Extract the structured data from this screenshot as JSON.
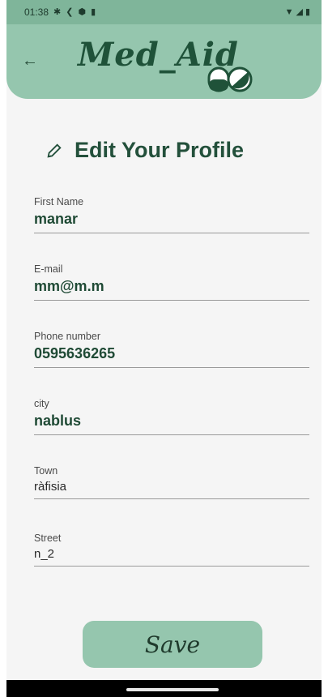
{
  "status_bar": {
    "time": "01:38",
    "left_icons": [
      "gear-icon",
      "back-chevron-icon",
      "shield-icon",
      "sd-card-icon"
    ],
    "right_icons": [
      "wifi-icon",
      "signal-icon",
      "battery-icon"
    ]
  },
  "header": {
    "title": "Med_Aid",
    "back_label": "←"
  },
  "page": {
    "title": "Edit Your Profile"
  },
  "form": {
    "fields": [
      {
        "label": "First Name",
        "value": "manar"
      },
      {
        "label": "E-mail",
        "value": "mm@m.m"
      },
      {
        "label": "Phone number",
        "value": "0595636265"
      },
      {
        "label": "city",
        "value": "nablus"
      },
      {
        "label": "Town",
        "value": "ràfisia"
      },
      {
        "label": "Street",
        "value": "n_2"
      }
    ]
  },
  "actions": {
    "save_label": "Save"
  },
  "colors": {
    "status_bar": "#7fb59a",
    "header": "#95c6ae",
    "accent_dark": "#1f5239",
    "background": "#f5f5f5"
  }
}
